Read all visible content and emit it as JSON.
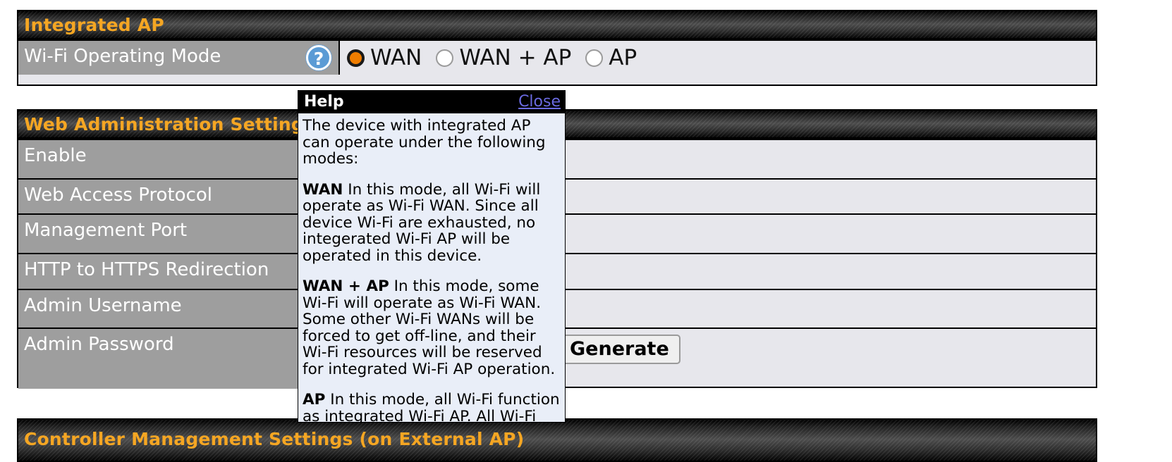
{
  "integrated_ap": {
    "title": "Integrated AP",
    "rows": [
      {
        "label": "Wi-Fi Operating Mode",
        "help_icon": "question-mark-icon",
        "options": [
          {
            "label": "WAN",
            "checked": true
          },
          {
            "label": "WAN + AP",
            "checked": false
          },
          {
            "label": "AP",
            "checked": false
          }
        ]
      }
    ]
  },
  "web_admin": {
    "title": "Web Administration Settings",
    "rows": [
      {
        "label": "Enable",
        "value": ""
      },
      {
        "label": "Web Access Protocol",
        "value": ""
      },
      {
        "label": "Management Port",
        "value": ""
      },
      {
        "label": "HTTP to HTTPS Redirection",
        "value": ""
      },
      {
        "label": "Admin Username",
        "value": "",
        "field": true,
        "placeholder": ""
      },
      {
        "label": "Admin Password",
        "value": "",
        "field": true,
        "placeholder": "",
        "button": "Generate"
      }
    ]
  },
  "controller": {
    "title": "Controller Management Settings (on External AP)"
  },
  "help": {
    "title": "Help",
    "close_label": "Close",
    "paragraphs": [
      {
        "lead": "",
        "text": "The device with integrated AP can operate under the following modes:"
      },
      {
        "lead": "WAN",
        "text": " In this mode, all Wi-Fi will operate as Wi-Fi WAN. Since all device Wi-Fi are exhausted, no integerated Wi-Fi AP will be operated in this device."
      },
      {
        "lead": "WAN + AP",
        "text": " In this mode, some Wi-Fi will operate as Wi-Fi WAN. Some other Wi-Fi WANs will be forced to get off-line, and their Wi-Fi resources will be reserved for integrated Wi-Fi AP operation."
      },
      {
        "lead": "AP",
        "text": " In this mode, all Wi-Fi function as integrated Wi-Fi AP. All Wi-Fi WANs will be forced to get off-line."
      }
    ]
  },
  "colors": {
    "accent_orange": "#f5a623",
    "radio_selected": "#ef7d00",
    "label_gray": "#9e9e9e",
    "value_gray": "#e7e7ec",
    "help_bg": "#e9eef8",
    "link_blue": "#6a6ae0",
    "help_icon_blue": "#5b9bd5"
  }
}
